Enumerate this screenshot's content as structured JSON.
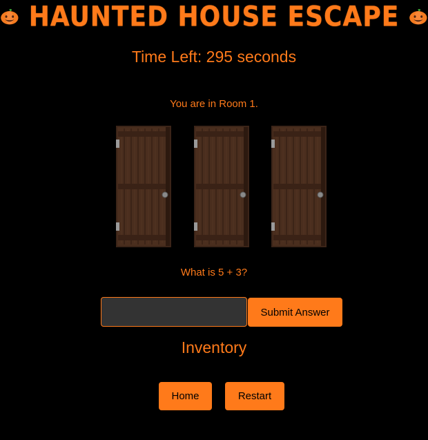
{
  "header": {
    "title": "HAUNTED HOUSE ESCAPE",
    "left_icon": "pumpkin-icon",
    "right_icon": "pumpkin-icon"
  },
  "timer": {
    "label": "Time Left:",
    "seconds": "295",
    "unit": "seconds"
  },
  "room": {
    "text": "You are in Room 1."
  },
  "doors": [
    {
      "icon": "door-icon"
    },
    {
      "icon": "door-icon"
    },
    {
      "icon": "door-icon"
    }
  ],
  "puzzle": {
    "question": "What is 5 + 3?",
    "answer_value": "",
    "submit_label": "Submit Answer"
  },
  "inventory": {
    "title": "Inventory",
    "items": []
  },
  "nav": {
    "home_label": "Home",
    "restart_label": "Restart"
  },
  "colors": {
    "accent": "#ff7a1a",
    "background": "#000000",
    "input_background": "#333333",
    "door_wood": "#4a2e1e"
  }
}
